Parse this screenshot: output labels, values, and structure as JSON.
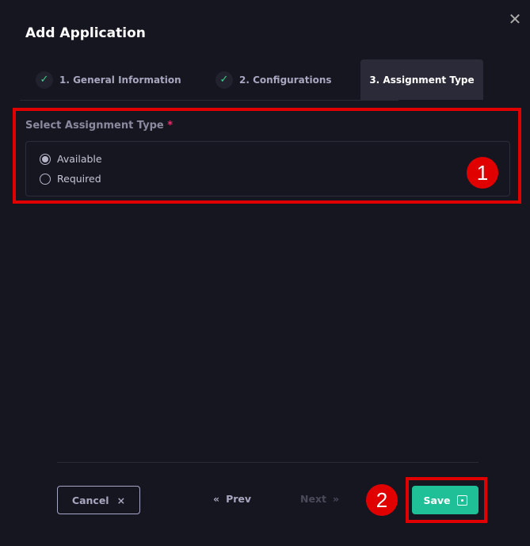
{
  "dialog": {
    "title": "Add Application"
  },
  "steps": [
    {
      "label": "1. General Information",
      "done": true
    },
    {
      "label": "2. Configurations",
      "done": true
    },
    {
      "label": "3. Assignment Type",
      "active": true
    }
  ],
  "form": {
    "label": "Select Assignment Type",
    "required_mark": "*",
    "options": [
      {
        "label": "Available",
        "selected": true
      },
      {
        "label": "Required",
        "selected": false
      }
    ]
  },
  "footer": {
    "cancel": "Cancel",
    "cancel_icon": "×",
    "prev": "Prev",
    "prev_icon": "«",
    "next": "Next",
    "next_icon": "»",
    "save": "Save"
  },
  "annotations": [
    "1",
    "2"
  ],
  "colors": {
    "accent": "#1fbf98",
    "annotation": "#e00000",
    "background": "#161621"
  }
}
